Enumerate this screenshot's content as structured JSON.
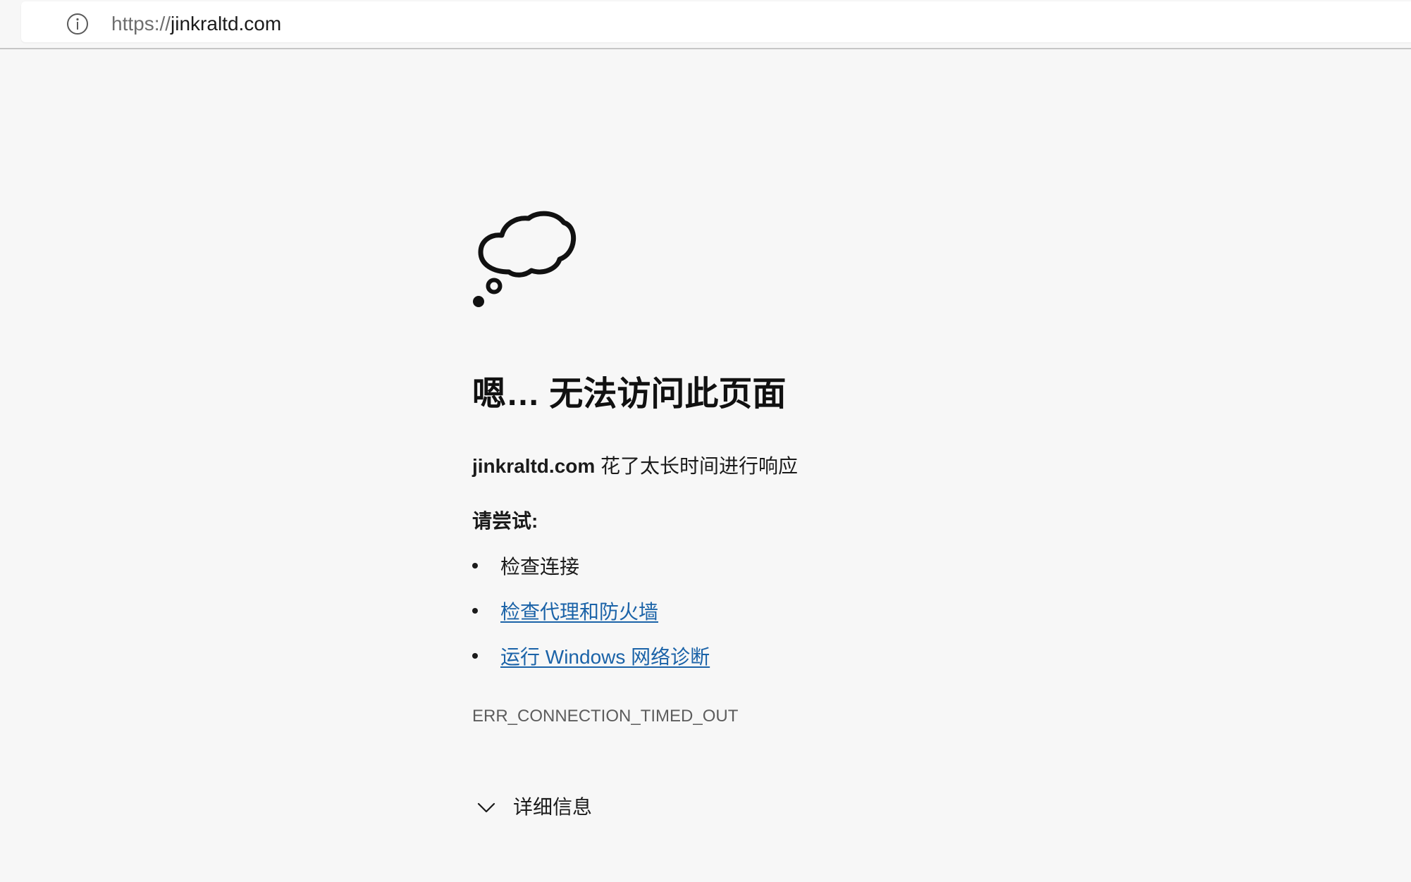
{
  "address_bar": {
    "icon": "info-icon",
    "url_scheme": "https://",
    "url_host": "jinkraltd.com"
  },
  "error_page": {
    "icon": "thought-cloud-icon",
    "heading": "嗯… 无法访问此页面",
    "message_host": "jinkraltd.com",
    "message_text": " 花了太长时间进行响应",
    "try_label": "请尝试:",
    "suggestions": [
      {
        "label": "检查连接",
        "is_link": false
      },
      {
        "label": "检查代理和防火墙",
        "is_link": true
      },
      {
        "label": "运行 Windows 网络诊断",
        "is_link": true
      }
    ],
    "error_code": "ERR_CONNECTION_TIMED_OUT",
    "details_label": "详细信息",
    "details_icon": "chevron-down-icon"
  },
  "colors": {
    "background": "#f7f7f7",
    "link": "#1b63a8",
    "text": "#1b1b1b",
    "muted": "#5d5d5d"
  }
}
